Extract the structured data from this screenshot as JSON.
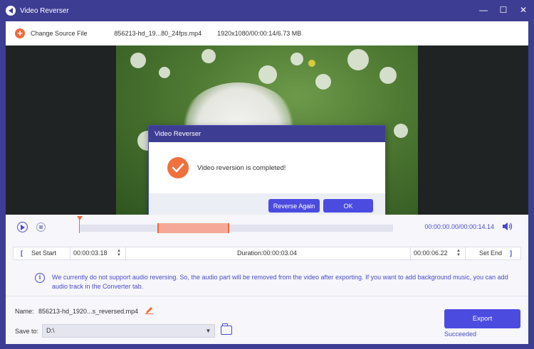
{
  "window": {
    "title": "Video Reverser",
    "controls": {
      "minimize": "—",
      "maximize": "☐",
      "close": "✕"
    }
  },
  "source": {
    "change_label": "Change Source File",
    "file_name": "856213-hd_19...80_24fps.mp4",
    "file_info": "1920x1080/00:00:14/6.73 MB"
  },
  "dialog": {
    "title": "Video Reverser",
    "message": "Video reversion is completed!",
    "reverse_again_label": "Reverse Again",
    "ok_label": "OK"
  },
  "playback": {
    "time_display": "00:00:00.00/00:00:14.14"
  },
  "cut": {
    "set_start_label": "Set Start",
    "start_time": "00:00:03.18",
    "duration": "Duration:00:00:03.04",
    "end_time": "00:00:06.22",
    "set_end_label": "Set End",
    "bracket_open": "[",
    "bracket_close": "]"
  },
  "notice": {
    "text": "We currently do not support audio reversing. So, the audio part will be removed from the video after exporting. If you want to add background music, you can add audio track in the Converter tab."
  },
  "output": {
    "name_label": "Name:",
    "name_value": "856213-hd_1920...s_reversed.mp4",
    "save_label": "Save to:",
    "save_path": "D:\\",
    "export_label": "Export",
    "status": "Succeeded"
  },
  "colors": {
    "accent": "#4b4be0",
    "brand": "#3d3d93",
    "orange": "#f06a3b"
  }
}
